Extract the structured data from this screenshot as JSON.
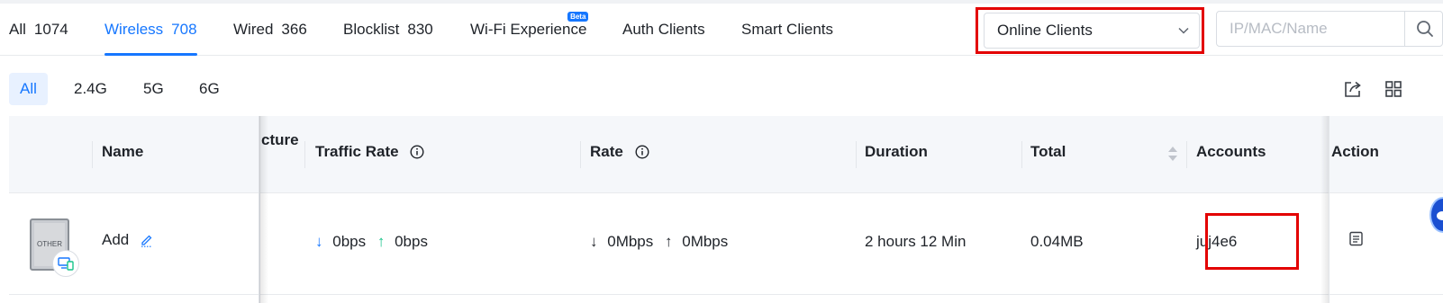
{
  "tabs": [
    {
      "label": "All",
      "count": "1074",
      "active": false
    },
    {
      "label": "Wireless",
      "count": "708",
      "active": true
    },
    {
      "label": "Wired",
      "count": "366",
      "active": false
    },
    {
      "label": "Blocklist",
      "count": "830",
      "active": false
    },
    {
      "label": "Wi-Fi Experience",
      "count": "",
      "badge": "Beta",
      "active": false
    },
    {
      "label": "Auth Clients",
      "count": "",
      "active": false
    },
    {
      "label": "Smart Clients",
      "count": "",
      "active": false
    }
  ],
  "filter": {
    "selected": "Online Clients"
  },
  "search": {
    "placeholder": "IP/MAC/Name",
    "value": ""
  },
  "bands": [
    {
      "label": "All",
      "active": true
    },
    {
      "label": "2.4G",
      "active": false
    },
    {
      "label": "5G",
      "active": false
    },
    {
      "label": "6G",
      "active": false
    }
  ],
  "table": {
    "columns": {
      "name": "Name",
      "structure_partial": "cture",
      "traffic_rate": "Traffic Rate",
      "rate": "Rate",
      "duration": "Duration",
      "total": "Total",
      "accounts": "Accounts",
      "action": "Action"
    },
    "rows": [
      {
        "device_type": "OTHER",
        "name": "Add",
        "traffic_down": "0bps",
        "traffic_up": "0bps",
        "rate_down": "0Mbps",
        "rate_up": "0Mbps",
        "duration": "2 hours 12 Min",
        "total": "0.04MB",
        "account": "juj4e6"
      }
    ]
  },
  "icons": {
    "select_chevron": "chevron-down-icon",
    "search": "search-icon",
    "export": "export-icon",
    "columns": "grid-icon",
    "info": "info-icon",
    "edit": "edit-icon",
    "detail": "detail-icon"
  },
  "colors": {
    "accent": "#1677ff",
    "upload_green": "#17c48a",
    "highlight_red": "#e30000",
    "header_bg": "#f5f7fa"
  }
}
